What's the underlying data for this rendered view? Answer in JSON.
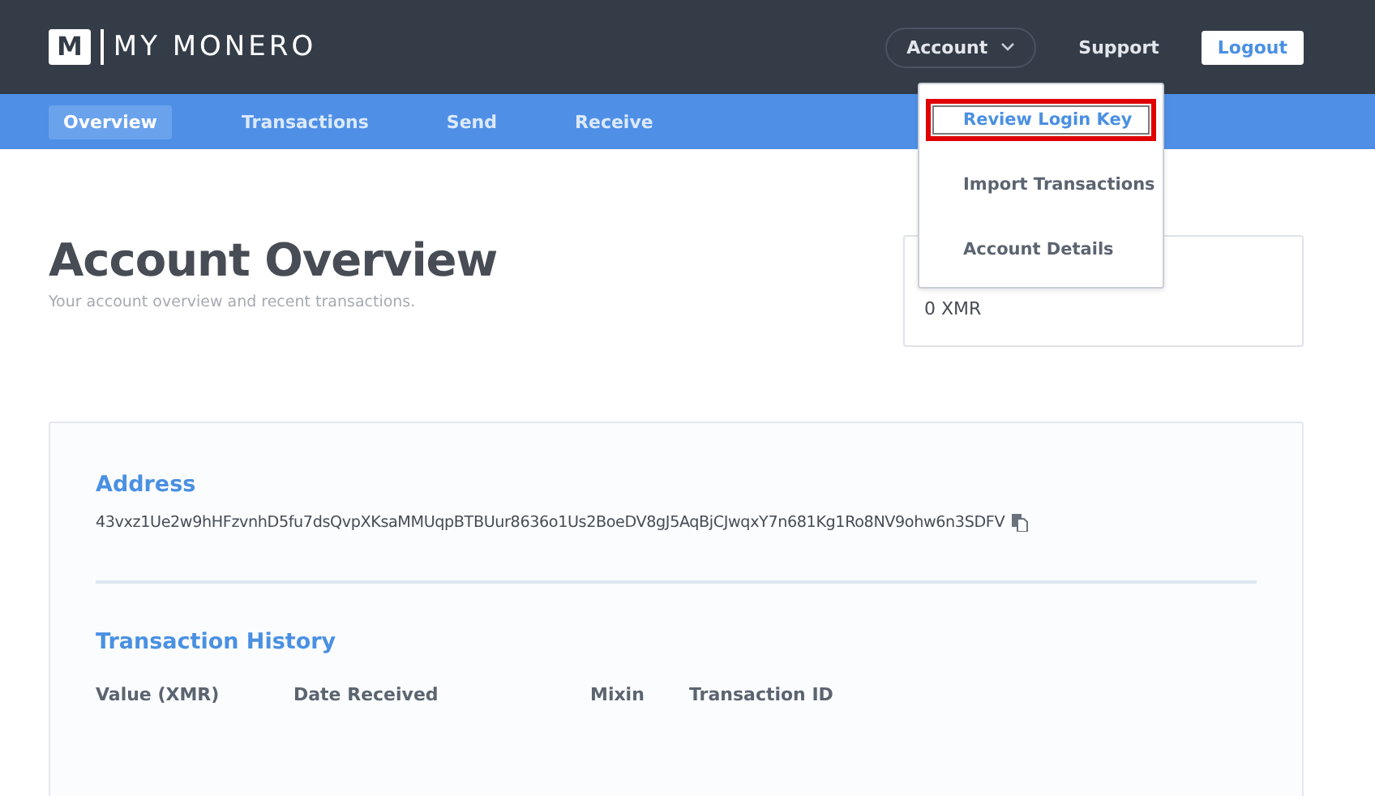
{
  "header": {
    "logo_mark": "M",
    "logo_text": "MY MONERO",
    "account_menu": {
      "label": "Account",
      "expanded": true,
      "items": [
        {
          "label": "Review Login Key",
          "highlighted": true
        },
        {
          "label": "Import Transactions",
          "highlighted": false
        },
        {
          "label": "Account Details",
          "highlighted": false
        }
      ]
    },
    "support": "Support",
    "logout": "Logout"
  },
  "nav": {
    "tabs": [
      {
        "label": "Overview",
        "selected": true
      },
      {
        "label": "Transactions",
        "selected": false
      },
      {
        "label": "Send",
        "selected": false
      },
      {
        "label": "Receive",
        "selected": false
      }
    ]
  },
  "page": {
    "title": "Account Overview",
    "subtitle": "Your account overview and recent transactions."
  },
  "balance_card": {
    "value": "0 XMR"
  },
  "address": {
    "heading": "Address",
    "value": "43vxz1Ue2w9hHFzvnhD5fu7dsQvpXKsaMMUqpBTBUur8636o1Us2BoeDV8gJ5AqBjCJwqxY7n681Kg1Ro8NV9ohw6n3SDFV"
  },
  "history": {
    "heading": "Transaction History",
    "columns": [
      "Value (XMR)",
      "Date Received",
      "Mixin",
      "Transaction ID"
    ]
  }
}
